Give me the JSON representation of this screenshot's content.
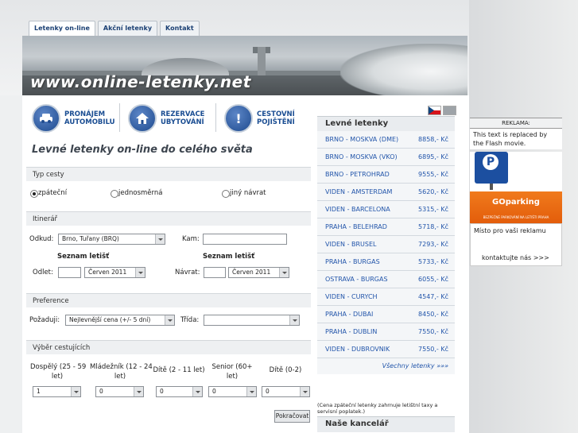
{
  "tabs": [
    "Letenky on-line",
    "Akční letenky",
    "Kontakt"
  ],
  "banner": {
    "url": "www.online-letenky.net"
  },
  "services": [
    {
      "line1": "PRONÁJEM",
      "line2": "AUTOMOBILU",
      "icon": "car-icon"
    },
    {
      "line1": "REZERVACE",
      "line2": "UBYTOVÁNÍ",
      "icon": "house-icon"
    },
    {
      "line1": "CESTOVNÍ",
      "line2": "POJIŠTĚNÍ",
      "icon": "exclamation-icon"
    }
  ],
  "heading": "Levné letenky on-line do celého světa",
  "form": {
    "trip_type": {
      "title": "Typ cesty",
      "options": [
        "zpáteční",
        "jednosměrná",
        "jiný návrat"
      ],
      "selected": "zpáteční"
    },
    "itinerary": {
      "title": "Itinerář",
      "from_label": "Odkud:",
      "from_value": "Brno, Tuřany (BRQ)",
      "to_label": "Kam:",
      "to_value": "",
      "airport_list": "Seznam letišť",
      "depart_label": "Odlet:",
      "depart_day": "",
      "depart_month": "Červen 2011",
      "return_label": "Návrat:",
      "return_day": "",
      "return_month": "Červen 2011"
    },
    "preferences": {
      "title": "Preference",
      "require_label": "Požaduji:",
      "require_value": "Nejlevnější cena (+/- 5 dní)",
      "class_label": "Třída:",
      "class_value": ""
    },
    "passengers": {
      "title": "Výběr cestujících",
      "groups": [
        {
          "label1": "Dospělý (25 - 59",
          "label2": "let)",
          "value": "1"
        },
        {
          "label1": "Mládežník (12 - 24",
          "label2": "let)",
          "value": "0"
        },
        {
          "label1": "Dítě (2 - 11 let)",
          "label2": "",
          "value": "0"
        },
        {
          "label1": "Senior (60+",
          "label2": "let)",
          "value": "0"
        },
        {
          "label1": "Dítě (0-2)",
          "label2": "",
          "value": "0"
        }
      ]
    },
    "continue": "Pokračovat"
  },
  "flights": {
    "title": "Levné letenky",
    "items": [
      {
        "route": "BRNO - MOSKVA (DME)",
        "price": "8858,- Kč"
      },
      {
        "route": "BRNO - MOSKVA (VKO)",
        "price": "6895,- Kč"
      },
      {
        "route": "BRNO - PETROHRAD",
        "price": "9555,- Kč"
      },
      {
        "route": "VIDEN - AMSTERDAM",
        "price": "5620,- Kč"
      },
      {
        "route": "VIDEN - BARCELONA",
        "price": "5315,- Kč"
      },
      {
        "route": "PRAHA - BELEHRAD",
        "price": "5718,- Kč"
      },
      {
        "route": "VIDEN - BRUSEL",
        "price": "7293,- Kč"
      },
      {
        "route": "PRAHA - BURGAS",
        "price": "5733,- Kč"
      },
      {
        "route": "OSTRAVA - BURGAS",
        "price": "6055,- Kč"
      },
      {
        "route": "VIDEN - CURYCH",
        "price": "4547,- Kč"
      },
      {
        "route": "PRAHA - DUBAI",
        "price": "8450,- Kč"
      },
      {
        "route": "PRAHA - DUBLIN",
        "price": "7550,- Kč"
      },
      {
        "route": "VIDEN - DUBROVNIK",
        "price": "7550,- Kč"
      }
    ],
    "all_link": "Všechny letenky »»»",
    "note": "(Cena zpáteční letenky zahrnuje letištní taxy a servisní poplatek.)",
    "office": "Naše kancelář"
  },
  "ad": {
    "title": "REKLAMA:",
    "flash_text": "This text is replaced by the Flash movie.",
    "p_sign_text": "P",
    "goparking": "GOparking",
    "goparking_sub": "BEZPEČNÉ PARKOVÁNÍ NA LETIŠTI PRAHA",
    "space_text": "Místo pro vaši reklamu",
    "contact_text": "kontaktujte nás >>>"
  },
  "colors": {
    "brand_blue": "#1a4d92",
    "link_blue": "#2255aa",
    "ad_orange": "#e35d0b"
  }
}
